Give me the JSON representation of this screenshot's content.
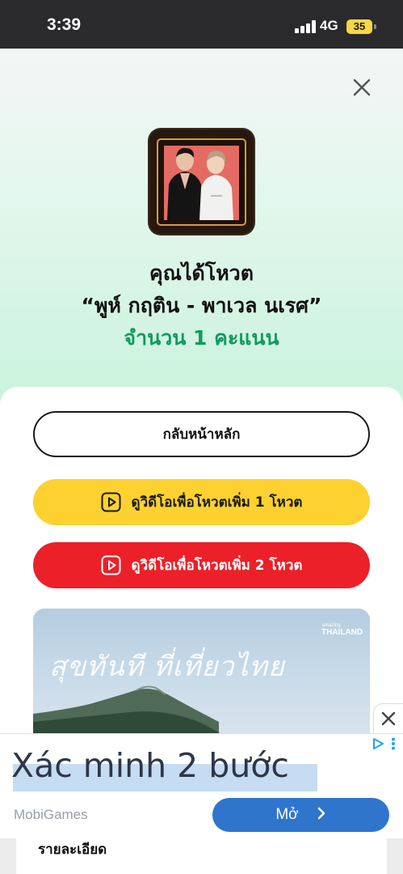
{
  "status_bar": {
    "time": "3:39",
    "network": "4G",
    "battery": "35"
  },
  "vote_result": {
    "line1": "คุณได้โหวต",
    "line2": "“พูห์ กฤติน - พาเวล นเรศ”",
    "line3": "จำนวน 1 คะแนน",
    "accent_color": "#129a5f"
  },
  "buttons": {
    "home": "กลับหน้าหลัก",
    "watch_one": "ดูวิดีโอเพื่อโหวตเพิ่ม 1 โหวต",
    "watch_two": "ดูวิดีโอเพื่อโหวตเพิ่ม 2 โหวต",
    "yellow_color": "#fdd12f",
    "red_color": "#ec2028"
  },
  "promo_image": {
    "script_text": "สุขทันที ที่เที่ยวไทย",
    "brand_small": "amazing",
    "brand": "THAILAND"
  },
  "ad": {
    "headline": "Xác minh 2 bước",
    "advertiser": "MobiGames",
    "cta": "Mở",
    "cta_color": "#2f75cc"
  },
  "details": {
    "label": "รายละเอียด"
  },
  "icons": [
    "close-icon",
    "play-icon",
    "chevron-right-icon",
    "adchoices-icon",
    "more-icon",
    "signal-icon",
    "battery-icon"
  ]
}
